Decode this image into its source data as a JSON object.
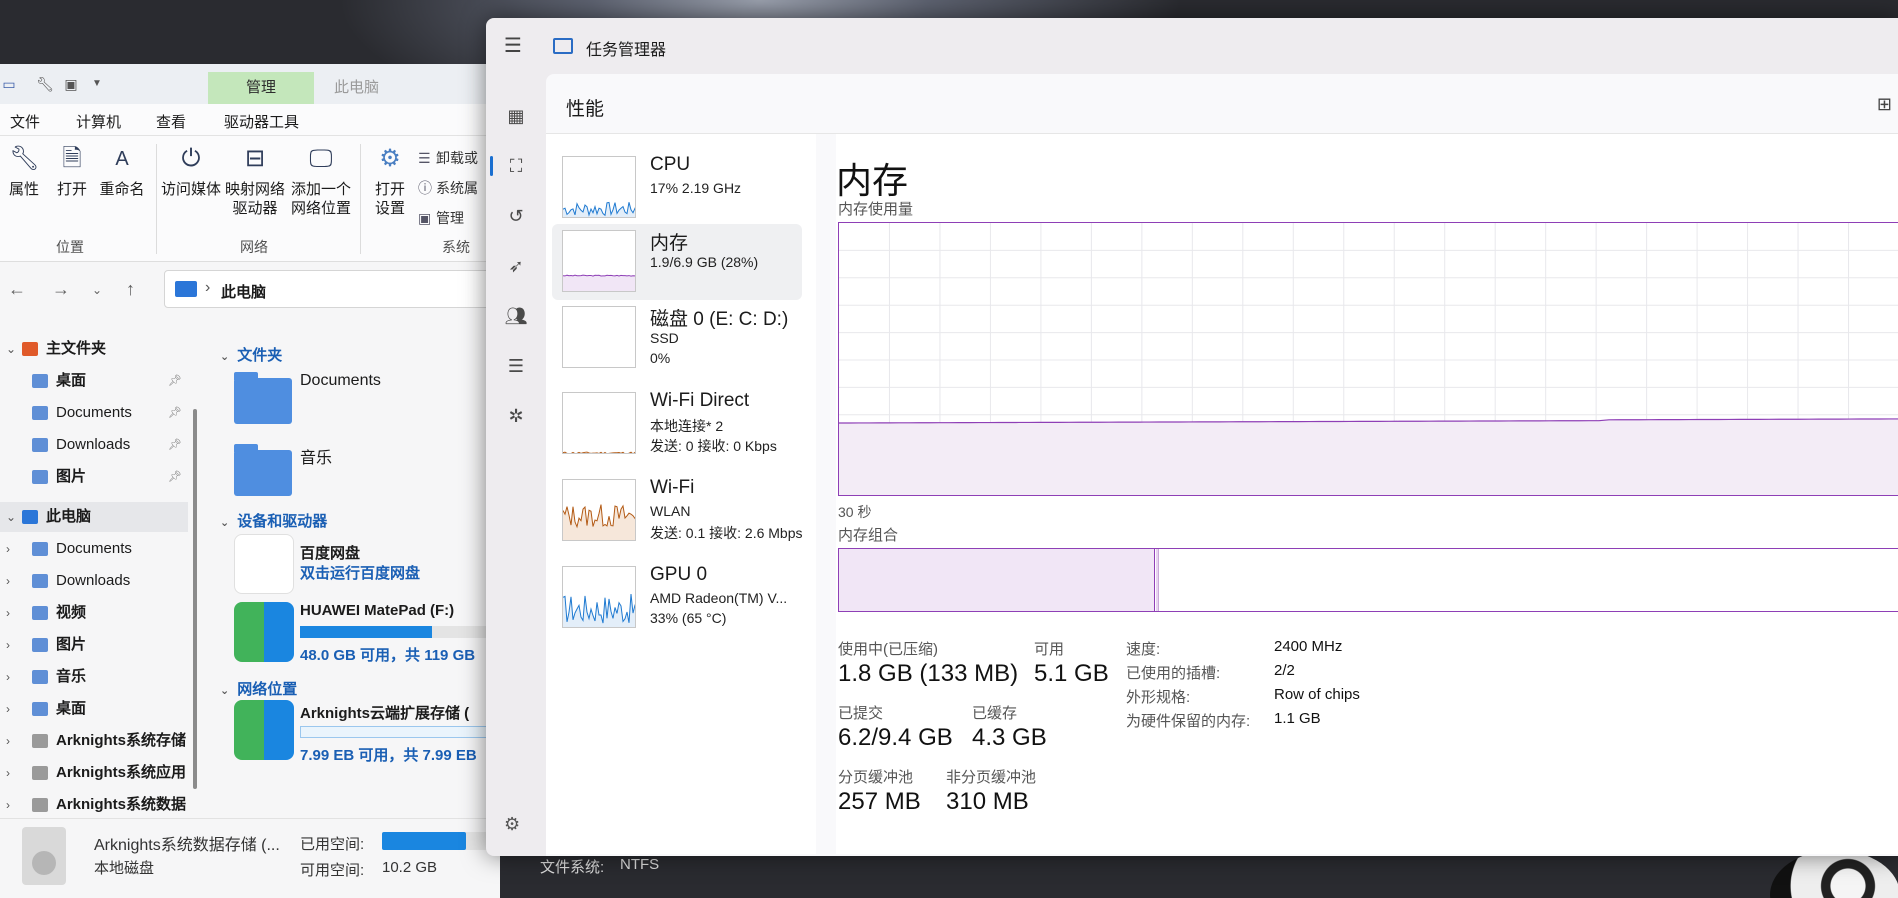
{
  "explorer": {
    "context_tab": "管理",
    "context_tab_dim": "此电脑",
    "ribbon_tabs": [
      "文件",
      "计算机",
      "查看",
      "驱动器工具"
    ],
    "ribbon": {
      "location": {
        "properties": "属性",
        "open": "打开",
        "rename": "重命名",
        "group": "位置"
      },
      "network": {
        "access_media": "访问媒体",
        "map_drive_1": "映射网络",
        "map_drive_2": "驱动器",
        "add_location_1": "添加一个",
        "add_location_2": "网络位置",
        "group": "网络"
      },
      "system": {
        "open_settings_1": "打开",
        "open_settings_2": "设置",
        "uninstall": "卸载或",
        "system_props": "系统属",
        "manage": "管理",
        "group": "系统"
      }
    },
    "address": {
      "crumb": "此电脑"
    },
    "tree": {
      "home": "主文件夹",
      "quick": [
        "桌面",
        "Documents",
        "Downloads",
        "图片"
      ],
      "this_pc": "此电脑",
      "pc_items": [
        "Documents",
        "Downloads",
        "视频",
        "图片",
        "音乐",
        "桌面",
        "Arknights系统存储",
        "Arknights系统应用",
        "Arknights系统数据"
      ]
    },
    "content": {
      "folders_header": "文件夹",
      "folders": [
        "Documents",
        "音乐"
      ],
      "devices_header": "设备和驱动器",
      "baidu_name": "百度网盘",
      "baidu_sub": "双击运行百度网盘",
      "huawei_name": "HUAWEI MatePad (F:)",
      "huawei_space": "48.0 GB 可用，共 119 GB",
      "huawei_used_fraction": 0.6,
      "network_header": "网络位置",
      "ark_name": "Arknights云端扩展存储 (",
      "ark_space": "7.99 EB 可用，共 7.99 EB",
      "ark_used_fraction": 0.0
    },
    "status": {
      "drive_name": "Arknights系统数据存储 (...",
      "drive_type": "本地磁盘",
      "used_label": "已用空间:",
      "free_label": "可用空间:",
      "free_value": "10.2 GB",
      "fs_label": "文件系统:",
      "fs_value": "NTFS"
    }
  },
  "taskmgr": {
    "title": "任务管理器",
    "page_title": "性能",
    "items": [
      {
        "name": "CPU",
        "line1": "17%  2.19 GHz",
        "line2": ""
      },
      {
        "name": "内存",
        "line1": "1.9/6.9 GB (28%)",
        "line2": ""
      },
      {
        "name": "磁盘 0 (E: C: D:)",
        "line1": "SSD",
        "line2": "0%"
      },
      {
        "name": "Wi-Fi Direct",
        "line1": "本地连接* 2",
        "line2": "发送: 0 接收: 0 Kbps"
      },
      {
        "name": "Wi-Fi",
        "line1": "WLAN",
        "line2": "发送: 0.1  接收: 2.6 Mbps"
      },
      {
        "name": "GPU 0",
        "line1": "AMD Radeon(TM) V...",
        "line2": "33%  (65 °C)"
      }
    ],
    "detail": {
      "title": "内存",
      "usage_label": "内存使用量",
      "time_label": "30 秒",
      "composition_label": "内存组合",
      "usage_fraction": 0.28,
      "in_use_label": "使用中(已压缩)",
      "in_use_value": "1.8 GB (133 MB)",
      "available_label": "可用",
      "available_value": "5.1 GB",
      "committed_label": "已提交",
      "committed_value": "6.2/9.4 GB",
      "cached_label": "已缓存",
      "cached_value": "4.3 GB",
      "paged_label": "分页缓冲池",
      "paged_value": "257 MB",
      "nonpaged_label": "非分页缓冲池",
      "nonpaged_value": "310 MB",
      "speed_label": "速度:",
      "speed_value": "2400 MHz",
      "slots_label": "已使用的插槽:",
      "slots_value": "2/2",
      "form_label": "外形规格:",
      "form_value": "Row of chips",
      "reserved_label": "为硬件保留的内存:",
      "reserved_value": "1.1 GB"
    },
    "colors": {
      "memory": "#8e3fb6",
      "cpu": "#1f7ad1",
      "wifi": "#b35a14",
      "accent": "#1a6fd0"
    }
  }
}
